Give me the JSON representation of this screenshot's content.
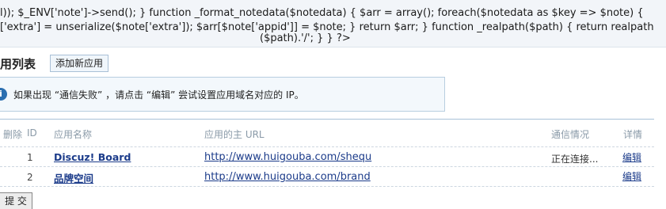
{
  "code": {
    "line1": "l)); $_ENV['note']->send(); } function _format_notedata($notedata) { $arr = array(); foreach($notedata as $key => $note) {",
    "line2": "['extra'] = unserialize($note['extra']); $arr[$note['appid']] = $note; } return $arr; } function _realpath($path) { return realpath",
    "line3": "($path).'/'; } } ?>"
  },
  "page": {
    "list_title": "用列表",
    "add_button": "添加新应用"
  },
  "notice": {
    "icon": "info-icon",
    "text": "如果出现 “通信失败” ，请点击 “编辑” 尝试设置应用域名对应的 IP。"
  },
  "table": {
    "headers": {
      "delete": "删除",
      "id": "ID",
      "name": "应用名称",
      "url": "应用的主 URL",
      "status": "通信情况",
      "detail": "详情"
    },
    "rows": [
      {
        "id": "1",
        "name": "Discuz! Board",
        "url": "http://www.huigouba.com/shequ",
        "status": "正在连接...",
        "action": "编辑"
      },
      {
        "id": "2",
        "name": "品牌空间",
        "url": "http://www.huigouba.com/brand",
        "status": "",
        "action": "编辑"
      }
    ]
  },
  "footer": {
    "submit_label": "提 交"
  }
}
